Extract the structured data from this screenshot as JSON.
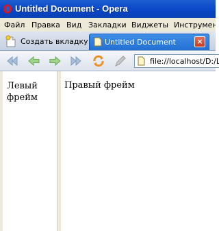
{
  "window": {
    "title": "Untitled Document - Opera"
  },
  "menu": [
    "Файл",
    "Правка",
    "Вид",
    "Закладки",
    "Виджеты",
    "Инструмент"
  ],
  "tabs": {
    "new_tab_label": "Создать вкладку",
    "active_tab_label": "Untitled Document",
    "close_symbol": "×"
  },
  "toolbar": {
    "buttons": [
      "rewind-icon",
      "back-icon",
      "forward-icon",
      "fast-forward-icon",
      "reload-icon",
      "edit-icon"
    ],
    "address": "file://localhost/D:/LE"
  },
  "frames": {
    "left_text": "Левый фрейм",
    "right_text": "Правый фрейм"
  },
  "colors": {
    "title_bar": "#0a46c8",
    "active_tab": "#2f80de",
    "tab_close": "#d9503a",
    "chrome_bg": "#ece9d8"
  }
}
